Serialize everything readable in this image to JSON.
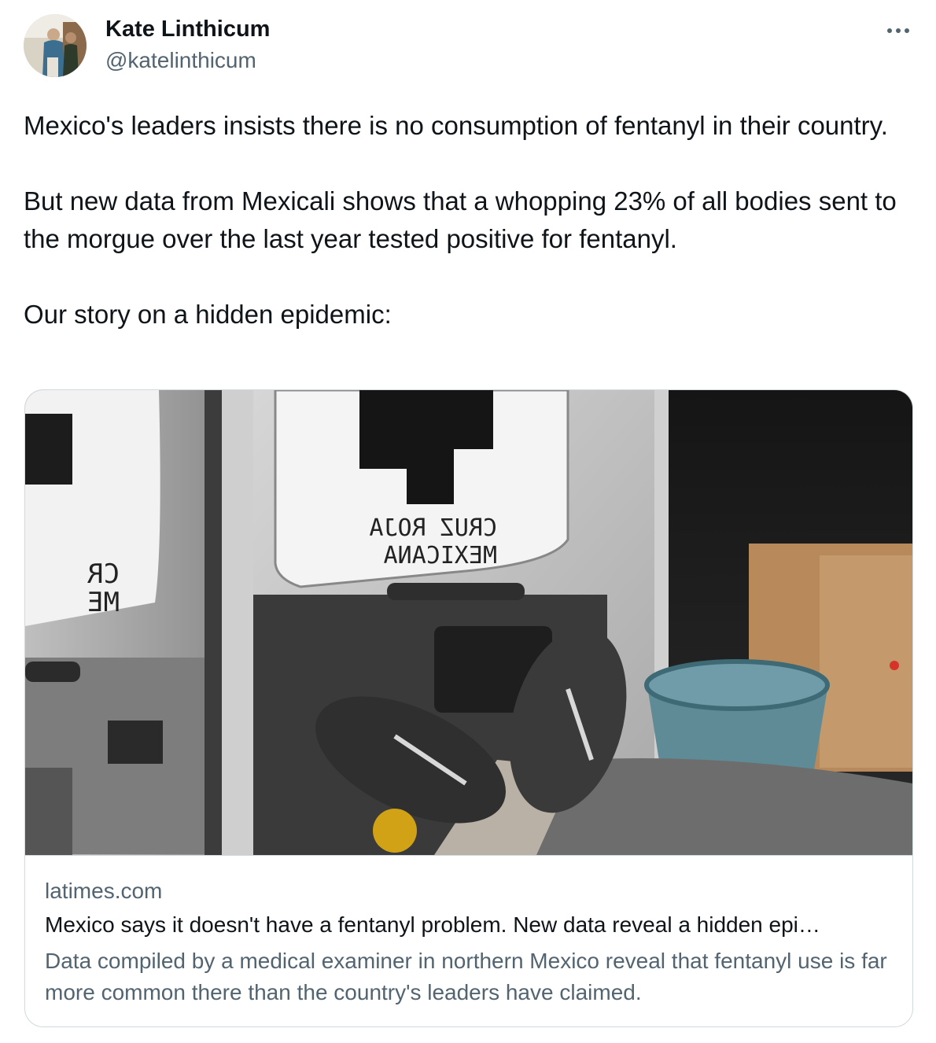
{
  "author": {
    "name": "Kate Linthicum",
    "handle": "@katelinthicum"
  },
  "tweet": {
    "paragraphs": [
      "Mexico's leaders insists there is no consumption of fentanyl in their country.",
      "But new data from Mexicali shows that a whopping 23% of all bodies sent to the morgue over the last year tested positive for fentanyl.",
      "Our story on a hidden epidemic:"
    ]
  },
  "card": {
    "domain": "latimes.com",
    "title": "Mexico says it doesn't have a fentanyl problem. New data reveal a hidden epi…",
    "description": "Data compiled by a medical examiner in northern Mexico reveal that fentanyl use is far more common there than the country's leaders have claimed.",
    "image_text": {
      "window_right_line1": "CRUZ ROJA",
      "window_right_line2": "MEXICANA",
      "window_left_line1": "CR",
      "window_left_line2": "ME"
    }
  },
  "icons": {
    "more": "more-horizontal-icon",
    "avatar": "profile-photo"
  },
  "colors": {
    "text_primary": "#0f1419",
    "text_secondary": "#536471",
    "border": "#cfd9de"
  }
}
